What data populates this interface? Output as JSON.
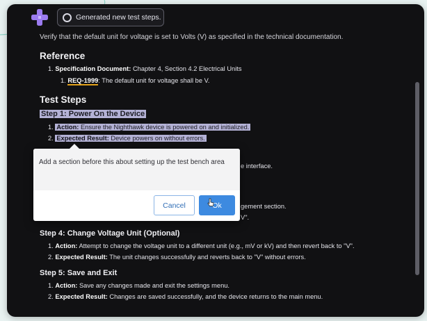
{
  "notification": {
    "text": "Generated new test steps."
  },
  "document": {
    "cut_line": "Verify that the default unit for voltage is set to Volts (V) as specified in the technical documentation.",
    "reference": {
      "heading": "Reference",
      "item1_num": "1.",
      "item1_label": "Specification Document:",
      "item1_text": " Chapter 4, Section 4.2 Electrical Units",
      "sub1_num": "1.",
      "sub1_req": "REQ-1999",
      "sub1_text": ": The default unit for voltage shall be V."
    },
    "test_steps": {
      "heading": "Test Steps",
      "step1": {
        "title": "Step 1: Power On the Device",
        "action_num": "1.",
        "action_label": "Action:",
        "action_text": " Ensure the Nighthawk device is powered on and initialized.",
        "result_num": "2.",
        "result_label": "Expected Result:",
        "result_text": " Device powers on without errors."
      },
      "partial_a": "e interface.",
      "partial_b": "gement section.",
      "partial_c": "V\".",
      "step4": {
        "title": "Step 4: Change Voltage Unit (Optional)",
        "action_num": "1.",
        "action_label": "Action:",
        "action_text": " Attempt to change the voltage unit to a different unit (e.g., mV or kV) and then revert back to \"V\".",
        "result_num": "2.",
        "result_label": "Expected Result:",
        "result_text": " The unit changes successfully and reverts back to \"V\" without errors."
      },
      "step5": {
        "title": "Step 5: Save and Exit",
        "action_num": "1.",
        "action_label": "Action:",
        "action_text": " Save any changes made and exit the settings menu.",
        "result_num": "2.",
        "result_label": "Expected Result:",
        "result_text": " Changes are saved successfully, and the device returns to the main menu."
      }
    }
  },
  "dialog": {
    "message": "Add a section before this about setting up the test bench area",
    "cancel_label": "Cancel",
    "ok_label": "Ok"
  },
  "colors": {
    "background": "#111113",
    "highlight": "#b4b2d6",
    "req_underline": "#e3a21a",
    "ok_button": "#3d8ae0"
  }
}
